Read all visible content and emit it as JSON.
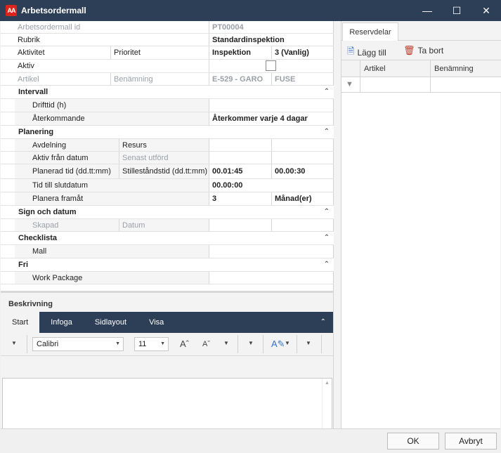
{
  "window": {
    "logo": "AA",
    "title": "Arbetsordermall"
  },
  "form": {
    "id_label": "Arbetsordermall id",
    "id_value": "PT00004",
    "rubrik_label": "Rubrik",
    "rubrik_value": "Standardinspektion",
    "aktivitet_label": "Aktivitet",
    "prioritet_label": "Prioritet",
    "aktivitet_value": "Inspektion",
    "prioritet_value": "3 (Vanlig)",
    "aktiv_label": "Aktiv",
    "artikel_label": "Artikel",
    "benamning_label": "Benämning",
    "artikel_value": "E-529 - GARO",
    "benamning_value": "FUSE"
  },
  "groups": {
    "intervall": {
      "title": "Intervall",
      "drifttid_label": "Drifttid (h)",
      "aterkommande_label": "Återkommande",
      "aterkommande_value": "Återkommer varje 4 dagar"
    },
    "planering": {
      "title": "Planering",
      "avdelning_label": "Avdelning",
      "resurs_label": "Resurs",
      "aktiv_fran_label": "Aktiv från datum",
      "senast_label": "Senast utförd",
      "planerad_label": "Planerad tid (dd.tt:mm)",
      "stillestand_label": "Stilleståndstid (dd.tt:mm)",
      "planerad_value": "00.01:45",
      "stillestand_value": "00.00:30",
      "tid_till_label": "Tid till slutdatum",
      "tid_till_value": "00.00:00",
      "planera_label": "Planera framåt",
      "planera_value": "3",
      "planera_unit": "Månad(er)"
    },
    "sign": {
      "title": "Sign och datum",
      "skapad_label": "Skapad",
      "datum_label": "Datum"
    },
    "checklista": {
      "title": "Checklista",
      "mall_label": "Mall"
    },
    "fri": {
      "title": "Fri",
      "work_package_label": "Work Package"
    }
  },
  "beskrivning": {
    "title": "Beskrivning",
    "tabs": [
      "Start",
      "Infoga",
      "Sidlayout",
      "Visa"
    ],
    "font_name": "Calibri",
    "font_size": "11"
  },
  "reservdelar": {
    "tab": "Reservdelar",
    "add_label": "Lägg till",
    "remove_label": "Ta bort",
    "col_artikel": "Artikel",
    "col_benamning": "Benämning"
  },
  "footer": {
    "ok_label": "OK",
    "cancel_label": "Avbryt"
  },
  "colors": {
    "titlebar": "#2d3f56",
    "accent": "#d9261c"
  }
}
